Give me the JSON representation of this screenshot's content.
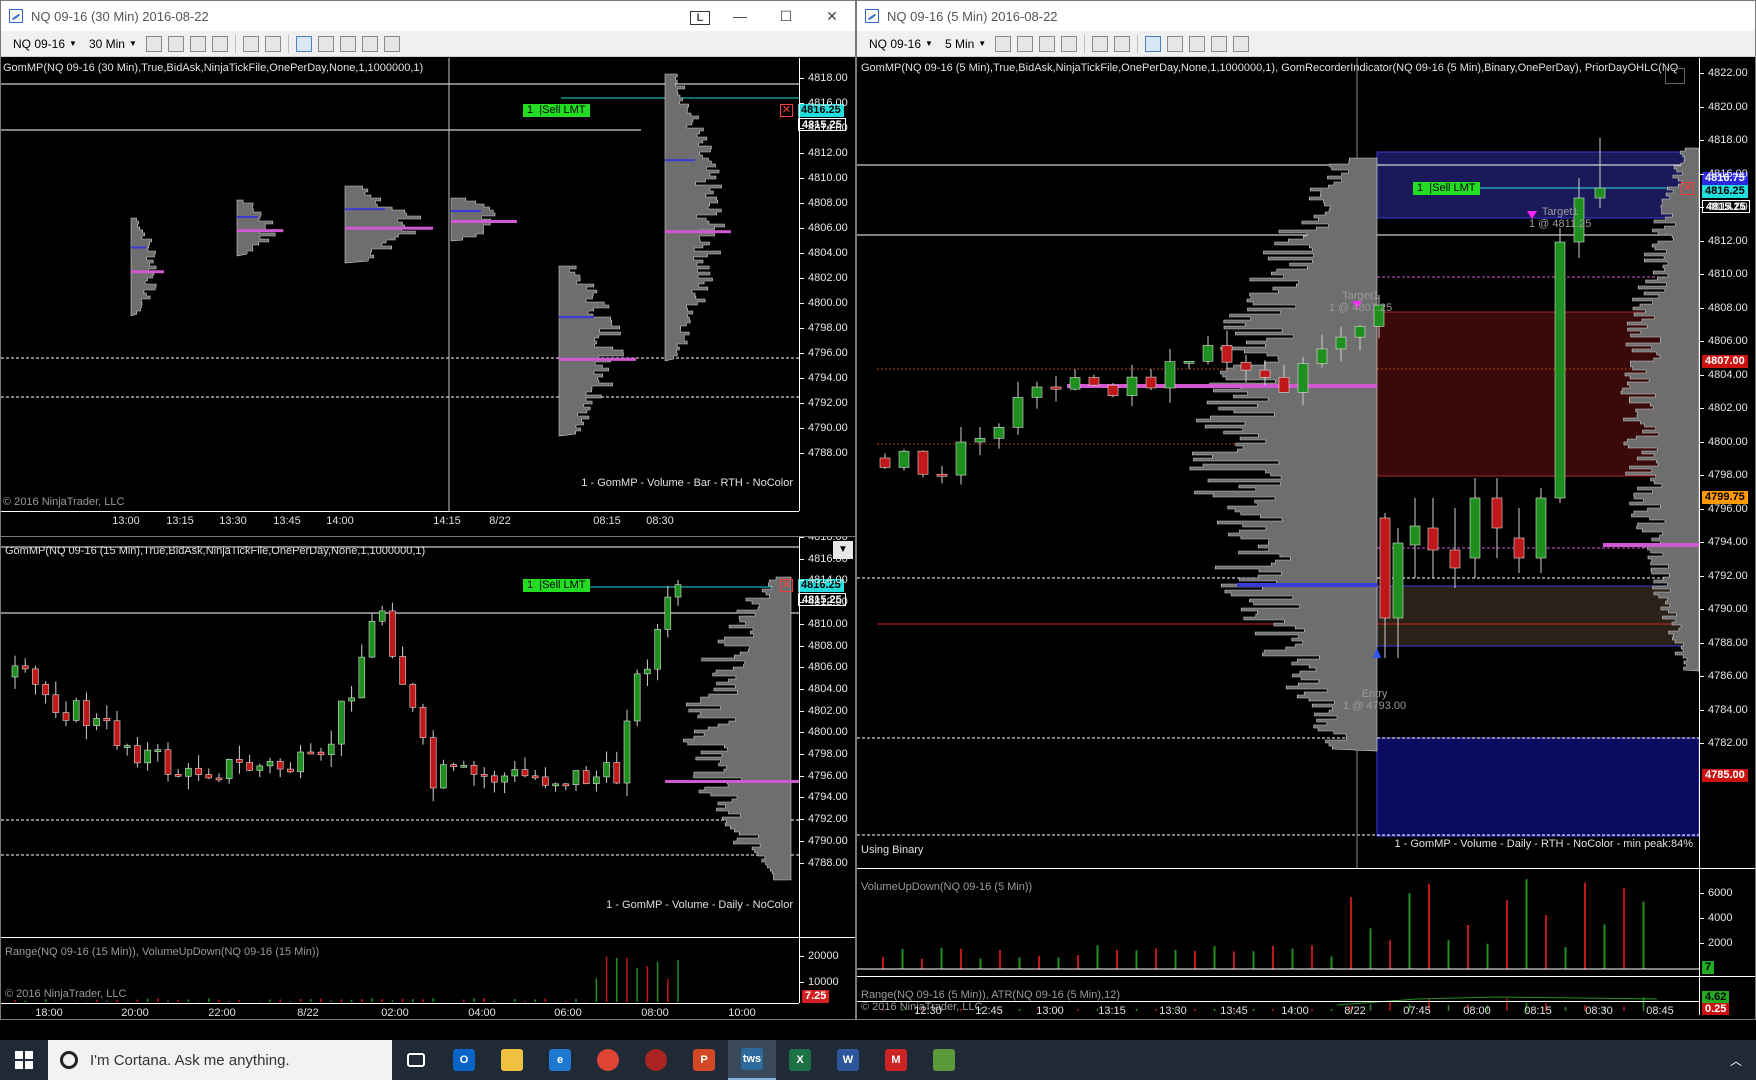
{
  "colors": {
    "bull": "#1f8f1f",
    "bear": "#c01818",
    "profile": "#6e6e6e",
    "poc": "#d257d2",
    "va": "#3a3ad8",
    "order_line": "#22dddd",
    "order_label": "#22dd22"
  },
  "win30": {
    "title": "NQ 09-16 (30 Min)  2016-08-22",
    "instrument": "NQ 09-16",
    "interval": "30 Min",
    "min_label": "L",
    "indicator": "GomMP(NQ 09-16 (30 Min),True,BidAsk,NinjaTickFile,OnePerDay,None,1,1000000,1)",
    "profile_label": "1 - GomMP  - Volume - Bar - RTH - NoColor",
    "copyright": "© 2016 NinjaTrader, LLC",
    "price_ticks": [
      "4818.00",
      "4816.00",
      "4814.00",
      "4812.00",
      "4810.00",
      "4808.00",
      "4806.00",
      "4804.00",
      "4802.00",
      "4800.00",
      "4798.00",
      "4796.00",
      "4794.00",
      "4792.00",
      "4790.00",
      "4788.00"
    ],
    "time_labels": [
      "13:00",
      "13:15",
      "13:30",
      "13:45",
      "14:00",
      "14:15",
      "8/22",
      "08:15",
      "08:30"
    ],
    "order": {
      "qty": "1",
      "label": "Sell LMT",
      "price": "4816.25"
    },
    "last_price": "4815.25"
  },
  "win15": {
    "indicator": "GomMP(NQ 09-16 (15 Min),True,BidAsk,NinjaTickFile,OnePerDay,None,1,1000000,1)",
    "profile_label": "1 - GomMP  - Volume - Daily - NoColor",
    "price_ticks": [
      "4818.00",
      "4816.00",
      "4814.00",
      "4812.00",
      "4810.00",
      "4808.00",
      "4806.00",
      "4804.00",
      "4802.00",
      "4800.00",
      "4798.00",
      "4796.00",
      "4794.00",
      "4792.00",
      "4790.00",
      "4788.00"
    ],
    "order": {
      "qty": "1",
      "label": "Sell LMT",
      "price": "4816.25"
    },
    "last_price": "4815.25",
    "sub_indicator": "Range(NQ 09-16 (15 Min)), VolumeUpDown(NQ 09-16 (15 Min))",
    "sub_ticks": [
      "20000",
      "10000"
    ],
    "sub_badge": "7.25",
    "copyright": "© 2016 NinjaTrader, LLC",
    "time_labels": [
      "18:00",
      "20:00",
      "22:00",
      "8/22",
      "02:00",
      "04:00",
      "06:00",
      "08:00",
      "10:00"
    ]
  },
  "win5": {
    "title": "NQ 09-16 (5 Min)  2016-08-22",
    "instrument": "NQ 09-16",
    "interval": "5 Min",
    "indicator": "GomMP(NQ 09-16 (5 Min),True,BidAsk,NinjaTickFile,OnePerDay,None,1,1000000,1), GomRecorderIndicator(NQ 09-16 (5 Min),Binary,OnePerDay), PriorDayOHLC(NQ",
    "price_ticks": [
      "4822.00",
      "4820.00",
      "4818.00",
      "4816.00",
      "4814.00",
      "4812.00",
      "4810.00",
      "4808.00",
      "4806.00",
      "4804.00",
      "4802.00",
      "4800.00",
      "4798.00",
      "4796.00",
      "4794.00",
      "4792.00",
      "4790.00",
      "4788.00",
      "4786.00",
      "4784.00",
      "4782.00"
    ],
    "badges": [
      {
        "text": "4816.75",
        "bg": "#2a2ae0",
        "fg": "#ffffff"
      },
      {
        "text": "4816.25",
        "bg": "#22dddd",
        "fg": "#000000"
      },
      {
        "text": "4815.25",
        "bg": "#000000",
        "fg": "#ffffff"
      },
      {
        "text": "4807.00",
        "bg": "#cc1111",
        "fg": "#ffffff"
      },
      {
        "text": "4799.75",
        "bg": "#ff9900",
        "fg": "#000000"
      },
      {
        "text": "4785.00",
        "bg": "#cc1111",
        "fg": "#ffffff"
      }
    ],
    "order": {
      "qty": "1",
      "label": "Sell LMT"
    },
    "annotations": [
      {
        "line1": "Target1",
        "line2": "1 @ 4807.25"
      },
      {
        "line1": "Target1",
        "line2": "1 @ 4811.25"
      },
      {
        "line1": "Entry",
        "line2": "1 @ 4793.00"
      }
    ],
    "status": "Using Binary",
    "profile_label": "1 - GomMP  - Volume - Daily - RTH - NoColor - min peak:84%",
    "vol_indicator": "VolumeUpDown(NQ 09-16 (5 Min))",
    "vol_ticks": [
      "6000",
      "4000",
      "2000",
      "0"
    ],
    "vol_badge": "7",
    "range_indicator": "Range(NQ 09-16 (5 Min)), ATR(NQ 09-16 (5 Min),12)",
    "range_badges": [
      "4.62",
      "0.25"
    ],
    "copyright": "© 2016 NinjaTrader, LLC",
    "time_labels": [
      "12:30",
      "12:45",
      "13:00",
      "13:15",
      "13:30",
      "13:45",
      "14:00",
      "8/22",
      "07:45",
      "08:00",
      "08:15",
      "08:30",
      "08:45"
    ]
  },
  "taskbar": {
    "search_placeholder": "I'm Cortana. Ask me anything.",
    "apps": [
      "task-view",
      "outlook",
      "file-explorer",
      "edge",
      "chrome",
      "app-red",
      "powerpoint",
      "tws",
      "excel",
      "word",
      "app-m",
      "ninjatrader"
    ]
  }
}
